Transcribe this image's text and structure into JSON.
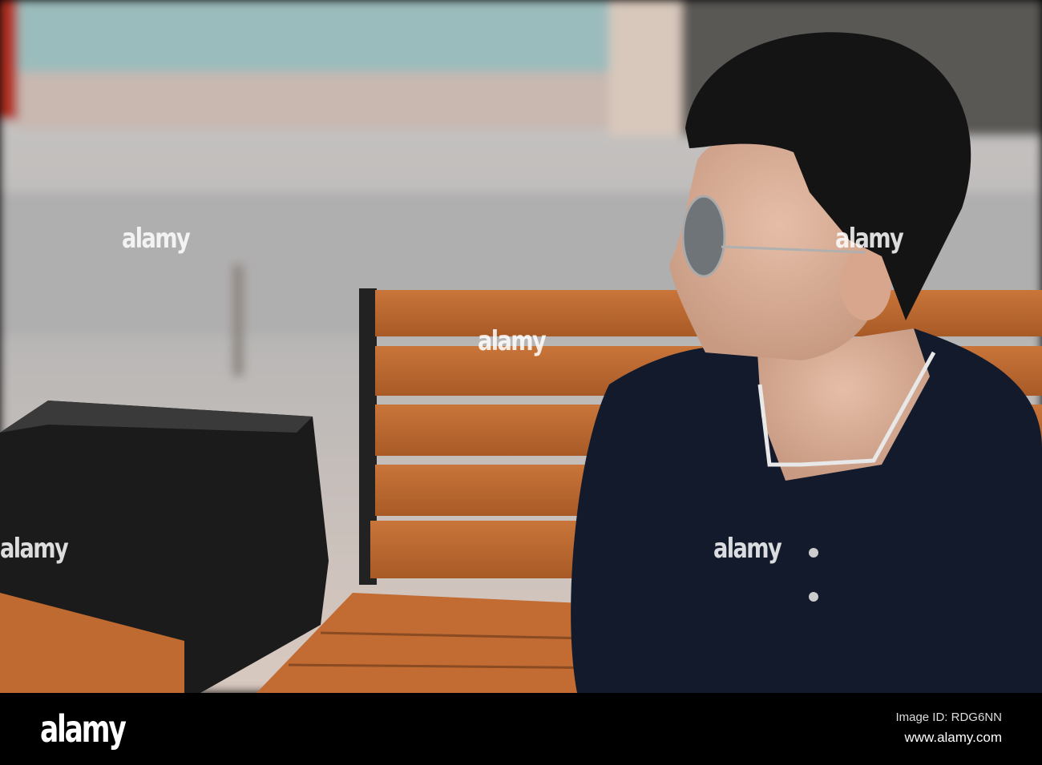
{
  "image": {
    "description_alt": "Man in sunglasses and dark shirt sitting on wooden bench",
    "watermark_text": "alamy"
  },
  "footer": {
    "logo": "alamy",
    "image_id": "Image ID: RDG6NN",
    "url": "www.alamy.com"
  }
}
